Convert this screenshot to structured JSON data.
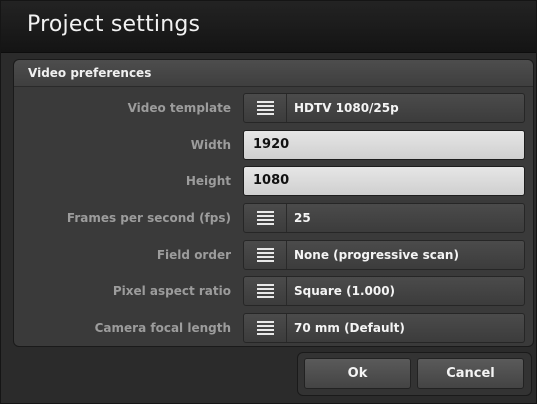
{
  "window": {
    "title": "Project settings"
  },
  "section": {
    "title": "Video preferences"
  },
  "fields": {
    "video_template": {
      "label": "Video template",
      "value": "HDTV 1080/25p",
      "icon": "menu-icon"
    },
    "width": {
      "label": "Width",
      "value": "1920"
    },
    "height": {
      "label": "Height",
      "value": "1080"
    },
    "fps": {
      "label": "Frames per second (fps)",
      "value": "25",
      "icon": "menu-icon"
    },
    "field_order": {
      "label": "Field order",
      "value": "None (progressive scan)",
      "icon": "menu-icon"
    },
    "pixel_aspect": {
      "label": "Pixel aspect ratio",
      "value": "Square (1.000)",
      "icon": "menu-icon"
    },
    "focal_length": {
      "label": "Camera focal length",
      "value": "70 mm (Default)",
      "icon": "menu-icon"
    }
  },
  "buttons": {
    "ok": "Ok",
    "cancel": "Cancel"
  },
  "colors": {
    "background": "#2b2b2b",
    "panel": "#3a3a3a",
    "input_bg": "#d9d9d9",
    "label": "#9c9c9c"
  }
}
